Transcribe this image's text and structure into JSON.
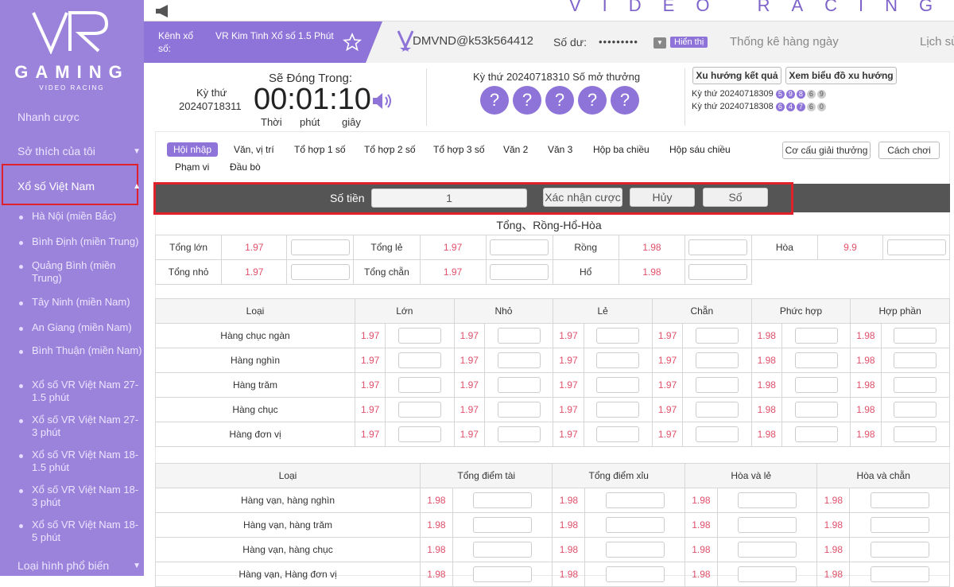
{
  "sidebar": {
    "logo_word": "GAMING",
    "logo_sub": "VIDEO RACING",
    "nav": [
      "Nhanh cược",
      "Sở thích của tôi",
      "Xổ số Việt Nam"
    ],
    "sub_items": [
      "Hà Nội (miền Bắc)",
      "Bình Định (miền Trung)",
      "Quảng Bình (miền Trung)",
      "Tây Ninh (miền Nam)",
      "An Giang (miền Nam)",
      "Bình Thuận (miền Nam)",
      "Xổ số VR Việt Nam 27-1.5 phút",
      "Xổ số VR Việt Nam 27-3 phút",
      "Xổ số VR Việt Nam 18-1.5 phút",
      "Xổ số VR Việt Nam 18-3 phút",
      "Xổ số VR Việt Nam 18-5 phút"
    ],
    "bottom": "Loại hình phổ biến"
  },
  "header": {
    "brand": "VIDEO RACING",
    "channel_label": "Kênh xổ số:",
    "channel_name": "VR Kim Tinh Xổ số 1.5 Phút",
    "account": "DMVND@k53k564412",
    "balance_label": "Số dư:",
    "balance_mask": "•••••••••",
    "show_btn": "Hiển thị",
    "daily_stats": "Thống kê hàng ngày",
    "history": "Lịch sử"
  },
  "draw": {
    "period_label": "Kỳ thứ",
    "period_no": "20240718311",
    "close_label": "Sẽ Đóng Trong:",
    "countdown": "00:01:10",
    "time_units": [
      "Thời",
      "phút",
      "giây"
    ],
    "next_title": "Kỳ thứ 20240718310  Số mở thưởng",
    "unknown": "?",
    "trend_btn": "Xu hướng kết quả",
    "chart_btn": "Xem biểu đồ xu hướng",
    "hist": [
      {
        "label": "Kỳ thứ 20240718309",
        "balls": [
          "5",
          "9",
          "8",
          "6",
          "9"
        ]
      },
      {
        "label": "Kỳ thứ 20240718308",
        "balls": [
          "6",
          "4",
          "7",
          "6",
          "0"
        ]
      }
    ]
  },
  "tabs": [
    "Hội nhập",
    "Văn, vị trí",
    "Tổ hợp 1 số",
    "Tổ hợp 2 số",
    "Tổ hợp 3 số",
    "Văn 2",
    "Văn 3",
    "Hộp ba chiều",
    "Hộp sáu chiều",
    "Phạm vi",
    "Đầu bò"
  ],
  "tab_buttons": [
    "Cơ cấu giải thưởng",
    "Cách chơi"
  ],
  "stake": {
    "label": "Số tiền",
    "value": "1",
    "confirm": "Xác nhận cược",
    "cancel": "Hủy",
    "number": "Số"
  },
  "section1": {
    "title": "Tổng、Rồng-Hổ-Hòa",
    "row1": [
      [
        "Tổng lớn",
        "1.97"
      ],
      [
        "Tổng lẻ",
        "1.97"
      ],
      [
        "Rồng",
        "1.98"
      ],
      [
        "Hòa",
        "9.9"
      ]
    ],
    "row2": [
      [
        "Tổng nhỏ",
        "1.97"
      ],
      [
        "Tổng chẵn",
        "1.97"
      ],
      [
        "Hổ",
        "1.98"
      ]
    ]
  },
  "table2": {
    "headers": [
      "Loại",
      "Lớn",
      "Nhỏ",
      "Lẻ",
      "Chẵn",
      "Phức hợp",
      "Hợp phần"
    ],
    "rows": [
      {
        "name": "Hàng chục ngàn",
        "odds": [
          "1.97",
          "1.97",
          "1.97",
          "1.97",
          "1.98",
          "1.98"
        ]
      },
      {
        "name": "Hàng nghìn",
        "odds": [
          "1.97",
          "1.97",
          "1.97",
          "1.97",
          "1.98",
          "1.98"
        ]
      },
      {
        "name": "Hàng trăm",
        "odds": [
          "1.97",
          "1.97",
          "1.97",
          "1.97",
          "1.98",
          "1.98"
        ]
      },
      {
        "name": "Hàng chục",
        "odds": [
          "1.97",
          "1.97",
          "1.97",
          "1.97",
          "1.98",
          "1.98"
        ]
      },
      {
        "name": "Hàng đơn vị",
        "odds": [
          "1.97",
          "1.97",
          "1.97",
          "1.97",
          "1.98",
          "1.98"
        ]
      }
    ]
  },
  "table3": {
    "headers": [
      "Loại",
      "Tổng điểm tài",
      "Tổng điểm xỉu",
      "Hòa và lẻ",
      "Hòa và chẵn"
    ],
    "rows": [
      {
        "name": "Hàng vạn, hàng nghìn",
        "odds": [
          "1.98",
          "1.98",
          "1.98",
          "1.98"
        ]
      },
      {
        "name": "Hàng vạn, hàng trăm",
        "odds": [
          "1.98",
          "1.98",
          "1.98",
          "1.98"
        ]
      },
      {
        "name": "Hàng vạn, hàng chục",
        "odds": [
          "1.98",
          "1.98",
          "1.98",
          "1.98"
        ]
      },
      {
        "name": "Hàng vạn, Hàng đơn vị",
        "odds": [
          "1.98",
          "1.98",
          "1.98",
          "1.98"
        ]
      }
    ]
  },
  "colors": {
    "accent": "#8e73d8",
    "sidebar": "#9b83dc",
    "odds": "#e0506a",
    "highlight": "#e0202a"
  }
}
